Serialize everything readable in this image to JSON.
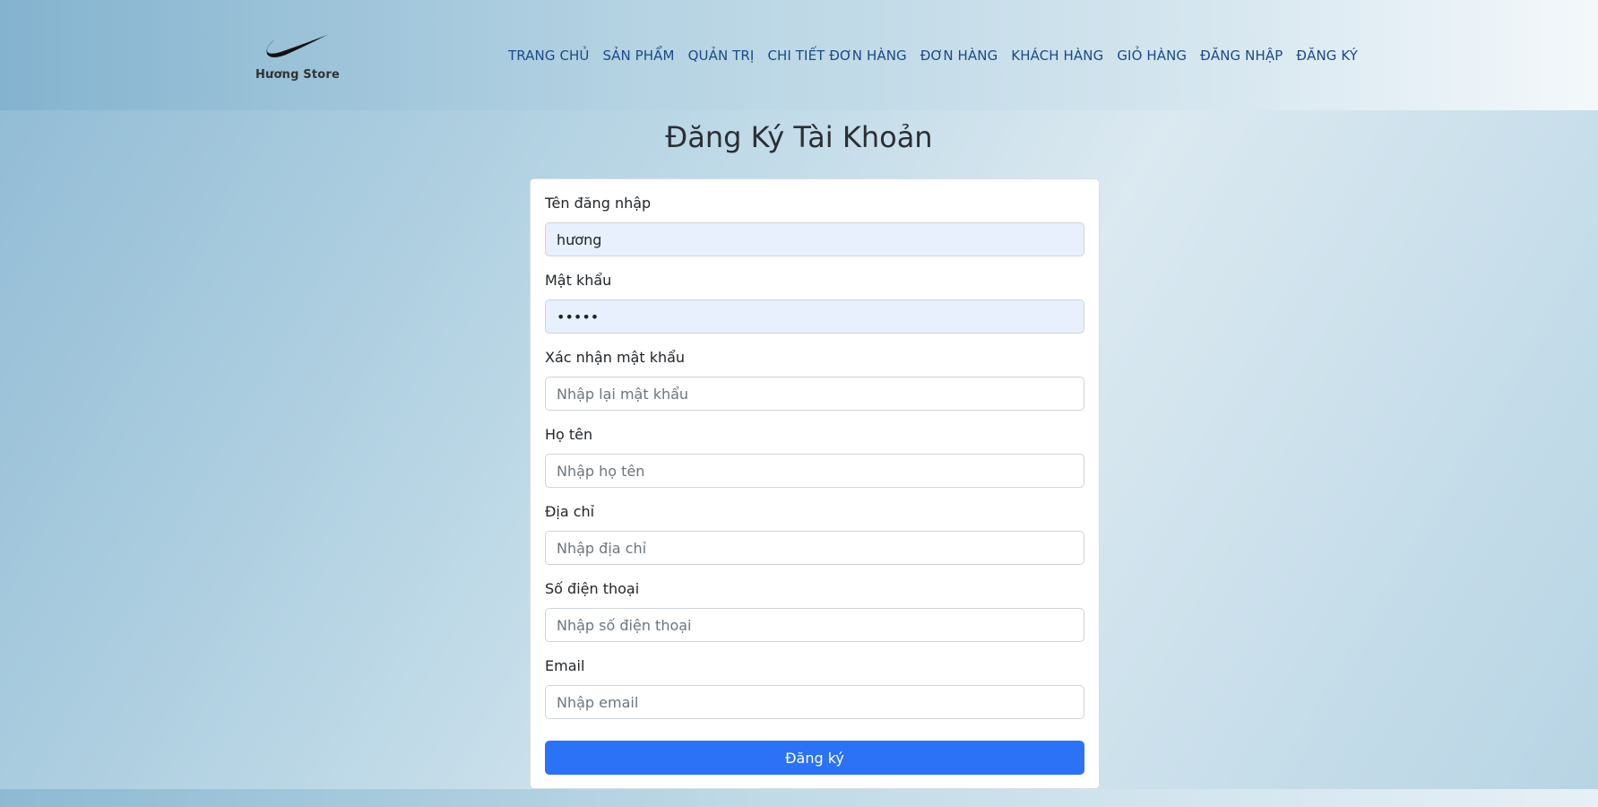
{
  "brand": {
    "name": "Hương Store",
    "logo_icon": "swoosh-icon"
  },
  "nav": {
    "items": [
      {
        "label": "TRANG CHỦ"
      },
      {
        "label": "SẢN PHẨM"
      },
      {
        "label": "QUẢN TRỊ"
      },
      {
        "label": "CHI TIẾT ĐƠN HÀNG"
      },
      {
        "label": "ĐƠN HÀNG"
      },
      {
        "label": "KHÁCH HÀNG"
      },
      {
        "label": "GIỎ HÀNG"
      },
      {
        "label": "ĐĂNG NHẬP"
      },
      {
        "label": "ĐĂNG KÝ"
      }
    ]
  },
  "page": {
    "title": "Đăng Ký Tài Khoản"
  },
  "form": {
    "username": {
      "label": "Tên đăng nhập",
      "value": "hương"
    },
    "password": {
      "label": "Mật khẩu",
      "value": "•••••"
    },
    "confirm_password": {
      "label": "Xác nhận mật khẩu",
      "placeholder": "Nhập lại mật khẩu"
    },
    "full_name": {
      "label": "Họ tên",
      "placeholder": "Nhập họ tên"
    },
    "address": {
      "label": "Địa chỉ",
      "placeholder": "Nhập địa chỉ"
    },
    "phone": {
      "label": "Số điện thoại",
      "placeholder": "Nhập số điện thoại"
    },
    "email": {
      "label": "Email",
      "placeholder": "Nhập email"
    },
    "submit_label": "Đăng ký"
  },
  "colors": {
    "accent": "#2b72f7",
    "nav_text": "#1b4a86",
    "autofill_bg": "#e8f0fe"
  }
}
